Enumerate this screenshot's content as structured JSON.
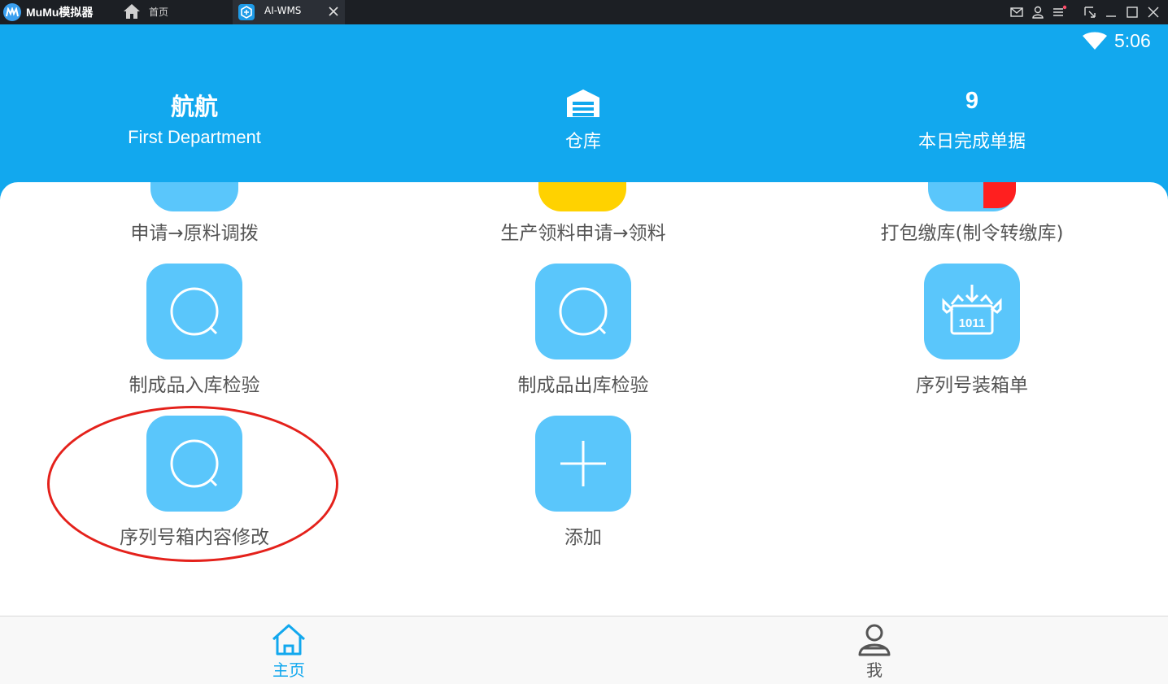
{
  "emulator": {
    "app_name": "MuMu模拟器",
    "tabs": [
      {
        "label": "首页",
        "icon": "home-icon",
        "active": false
      },
      {
        "label": "AI-WMS",
        "icon": "ai-wms-app-icon",
        "active": true
      }
    ]
  },
  "status_bar": {
    "time": "5:06",
    "icons": [
      "wifi-icon"
    ]
  },
  "header": {
    "user": {
      "name": "航航",
      "department": "First Department"
    },
    "warehouse": {
      "icon": "warehouse-icon",
      "label": "仓库"
    },
    "completed": {
      "count": "9",
      "label": "本日完成单据"
    }
  },
  "grid": {
    "partial_row": [
      {
        "label": "申请→原料调拨",
        "color": "#5ac6fb"
      },
      {
        "label": "生产领料申请→领料",
        "color": "#ffd200"
      },
      {
        "label": "打包缴库(制令转缴库)",
        "color": "#5ac6fb"
      }
    ],
    "rows": [
      [
        {
          "label": "制成品入库检验",
          "icon": "search-icon"
        },
        {
          "label": "制成品出库检验",
          "icon": "search-icon"
        },
        {
          "label": "序列号装箱单",
          "icon": "box-1011-icon",
          "icon_text": "1011"
        }
      ],
      [
        {
          "label": "序列号箱内容修改",
          "icon": "search-icon"
        },
        {
          "label": "添加",
          "icon": "plus-icon"
        }
      ]
    ]
  },
  "bottom_nav": [
    {
      "label": "主页",
      "icon": "home-outline-icon",
      "active": true
    },
    {
      "label": "我",
      "icon": "user-icon",
      "active": false
    }
  ],
  "colors": {
    "header_bg": "#12a8ee",
    "tile_bg": "#5ac6fb",
    "active_nav": "#12a8ee",
    "inactive_nav": "#555555",
    "annotation": "#e4211b"
  }
}
